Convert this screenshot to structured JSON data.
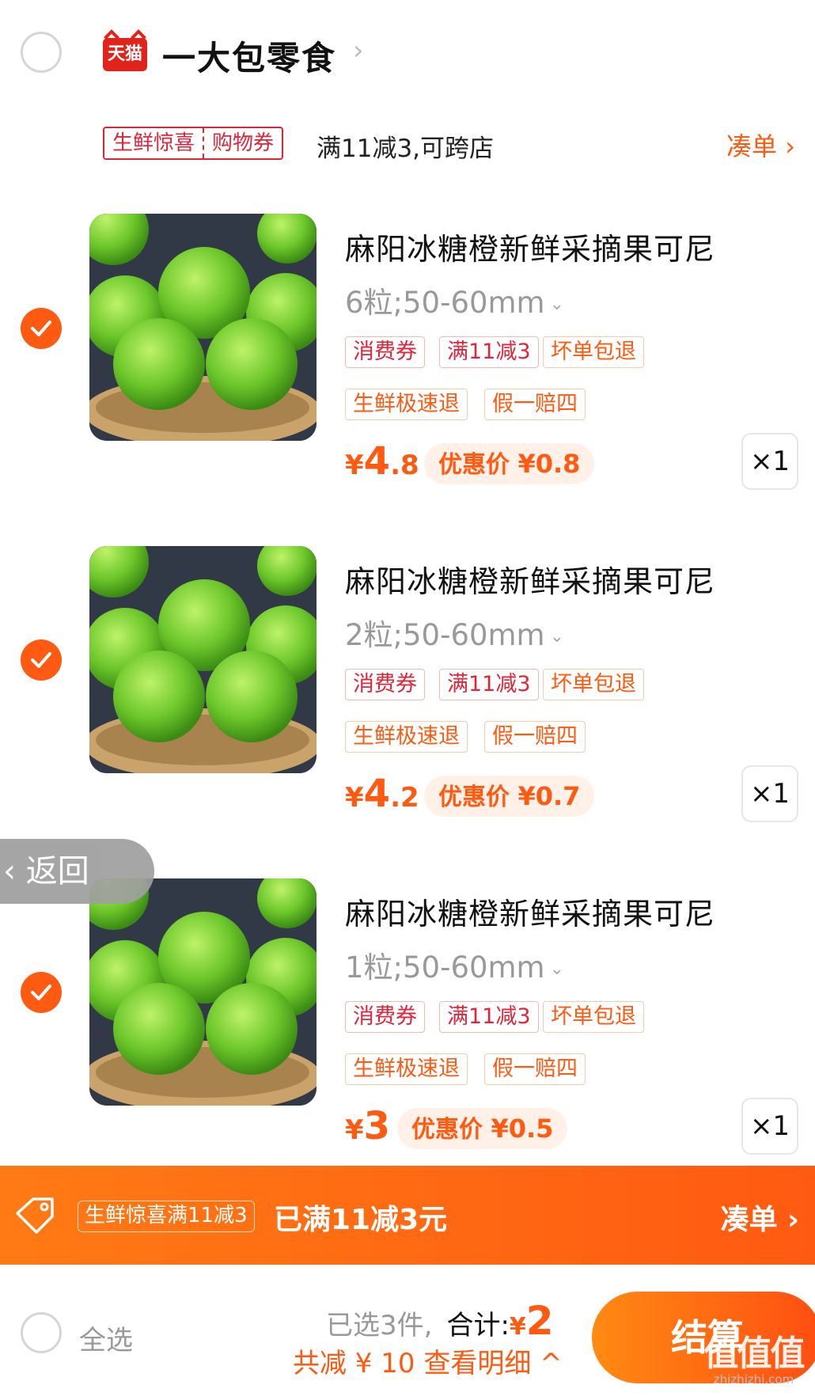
{
  "shop": {
    "logo_text": "天猫",
    "name": "一大包零食",
    "chevron": "›"
  },
  "coupon": {
    "tag_left": "生鲜惊喜",
    "tag_right": "购物券",
    "description": "满11减3,可跨店",
    "link": "凑单 ›"
  },
  "products": [
    {
      "title": "麻阳冰糖橙新鲜采摘果可尼",
      "spec": "6粒;50-60mm",
      "tags_row1": [
        "消费券",
        "满11减3",
        "坏单包退"
      ],
      "tags_row2": [
        "生鲜极速退",
        "假一赔四"
      ],
      "price_currency": "¥",
      "price_int": "4",
      "price_dec": ".8",
      "discount_label": "优惠价",
      "discount_value": "¥0.8",
      "quantity": "×1",
      "checked": true
    },
    {
      "title": "麻阳冰糖橙新鲜采摘果可尼",
      "spec": "2粒;50-60mm",
      "tags_row1": [
        "消费券",
        "满11减3",
        "坏单包退"
      ],
      "tags_row2": [
        "生鲜极速退",
        "假一赔四"
      ],
      "price_currency": "¥",
      "price_int": "4",
      "price_dec": ".2",
      "discount_label": "优惠价",
      "discount_value": "¥0.7",
      "quantity": "×1",
      "checked": true
    },
    {
      "title": "麻阳冰糖橙新鲜采摘果可尼",
      "spec": "1粒;50-60mm",
      "tags_row1": [
        "消费券",
        "满11减3",
        "坏单包退"
      ],
      "tags_row2": [
        "生鲜极速退",
        "假一赔四"
      ],
      "price_currency": "¥",
      "price_int": "3",
      "price_dec": "",
      "discount_label": "优惠价",
      "discount_value": "¥0.5",
      "quantity": "×1",
      "checked": true
    }
  ],
  "back_button": "‹ 返回",
  "promo_bar": {
    "tag": "生鲜惊喜满11减3",
    "text": "已满11减3元",
    "link": "凑单 ›"
  },
  "bottom_bar": {
    "select_all": "全选",
    "selected_count": "已选3件,",
    "total_label": "合计:",
    "total_currency": "¥",
    "total_value": "2",
    "saved_text": "共减 ¥ 10  查看明细 ^",
    "checkout": "结算"
  },
  "watermark": {
    "glyphs": "值值值",
    "url": "zhizhizhi.com"
  },
  "colors": {
    "accent": "#ff5a12",
    "tag_red": "#e0253a",
    "tmall_red": "#e2231a"
  }
}
